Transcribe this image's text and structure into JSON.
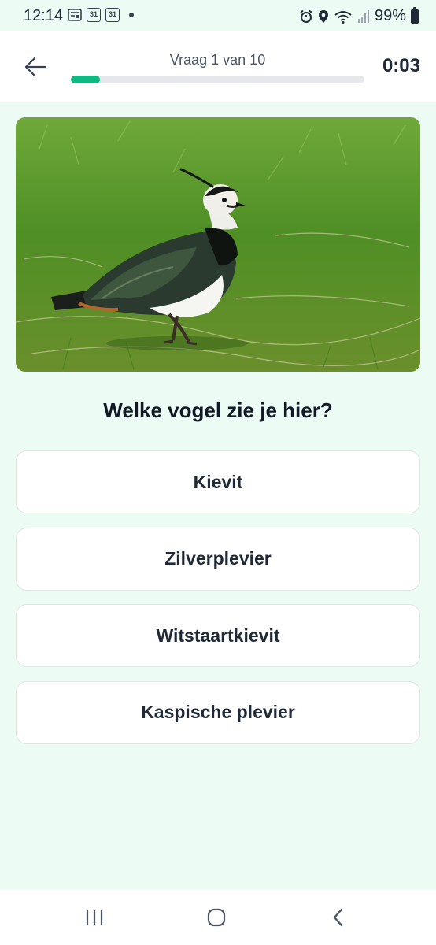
{
  "status_bar": {
    "time": "12:14",
    "calendar_day_1": "31",
    "calendar_day_2": "31",
    "battery": "99%"
  },
  "quiz": {
    "progress_label": "Vraag 1 van 10",
    "progress_fraction": 0.1,
    "timer": "0:03",
    "question": "Welke vogel zie je hier?",
    "answers": [
      "Kievit",
      "Zilverplevier",
      "Witstaartkievit",
      "Kaspische plevier"
    ]
  },
  "colors": {
    "accent": "#10b981",
    "background": "#ecfbf3"
  },
  "icons": {
    "back": "arrow-left-icon",
    "nav_recents": "recents-icon",
    "nav_home": "home-icon",
    "nav_back": "chevron-left-icon"
  }
}
